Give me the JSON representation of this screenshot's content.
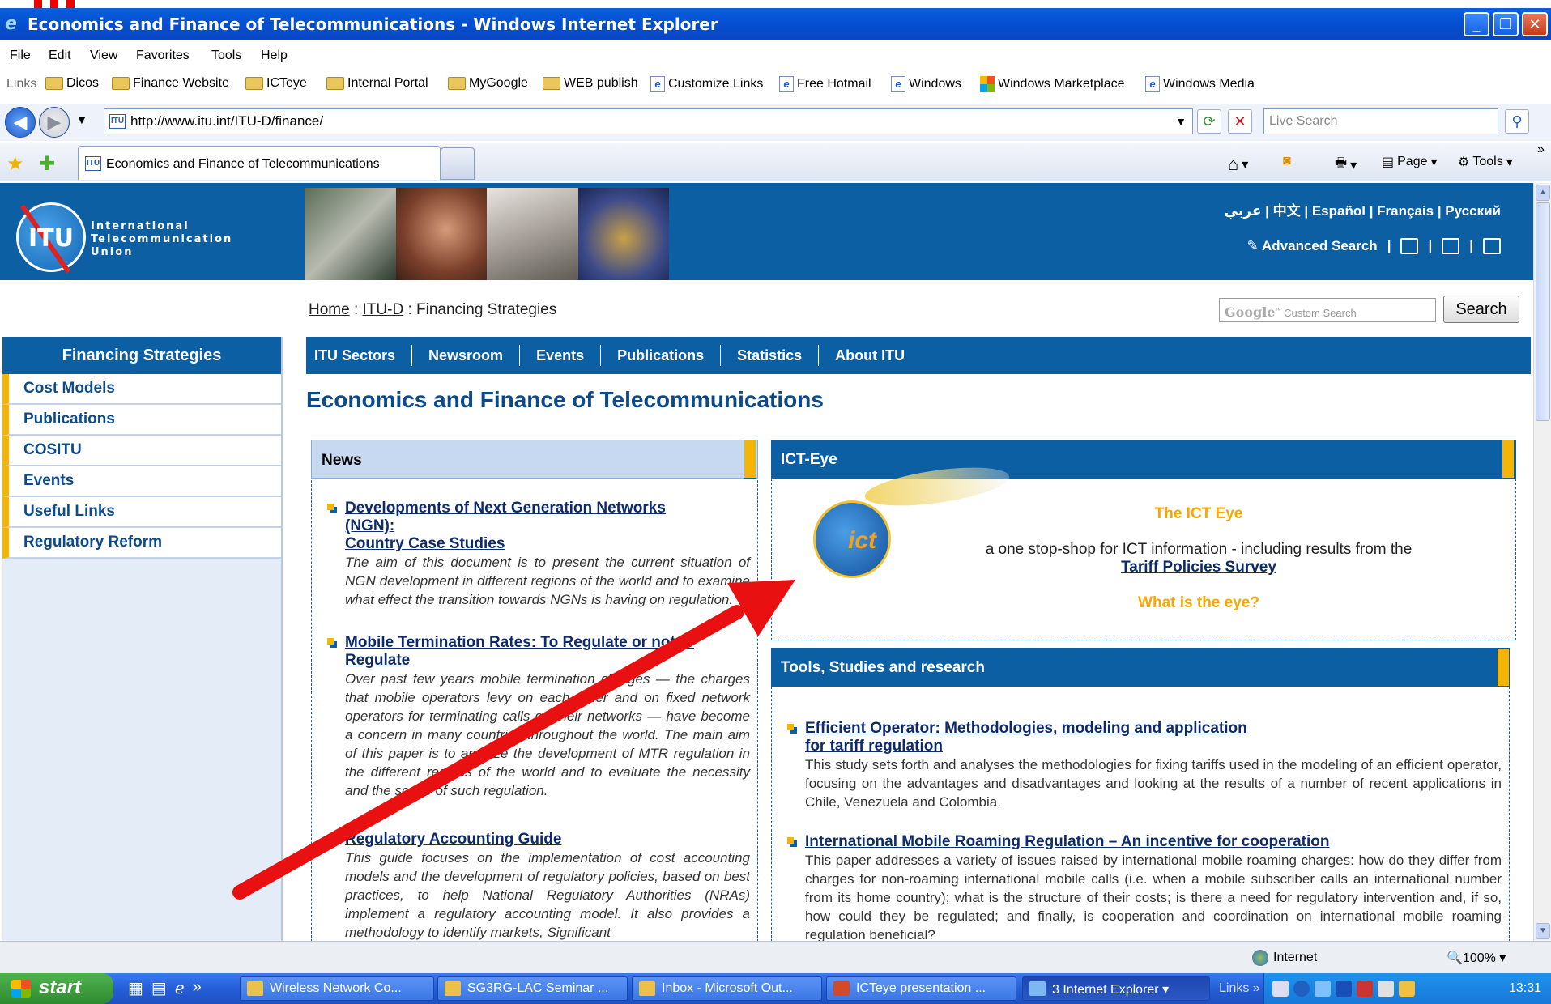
{
  "window": {
    "title": "Economics and Finance of Telecommunications - Windows Internet Explorer",
    "buttons": [
      "_",
      "❐",
      "✕"
    ]
  },
  "menu": [
    "File",
    "Edit",
    "View",
    "Favorites",
    "Tools",
    "Help"
  ],
  "links_bar": {
    "label": "Links",
    "items": [
      {
        "label": "Dicos",
        "icon": "folder-icon"
      },
      {
        "label": "Finance Website",
        "icon": "folder-icon"
      },
      {
        "label": "ICTeye",
        "icon": "folder-icon"
      },
      {
        "label": "Internal Portal",
        "icon": "folder-icon"
      },
      {
        "label": "MyGoogle",
        "icon": "folder-icon"
      },
      {
        "label": "WEB publish",
        "icon": "folder-icon"
      },
      {
        "label": "Customize Links",
        "icon": "ie-page-icon"
      },
      {
        "label": "Free Hotmail",
        "icon": "ie-page-icon"
      },
      {
        "label": "Windows",
        "icon": "ie-page-icon"
      },
      {
        "label": "Windows Marketplace",
        "icon": "windows-icon"
      },
      {
        "label": "Windows Media",
        "icon": "ie-page-icon"
      }
    ]
  },
  "address": {
    "url": "http://www.itu.int/ITU-D/finance/",
    "search_placeholder": "Live Search"
  },
  "tab": {
    "title": "Economics and Finance of Telecommunications"
  },
  "command_bar": {
    "page": "Page",
    "tools": "Tools"
  },
  "itu": {
    "org_name": [
      "International",
      "Telecommunication",
      "Union"
    ],
    "logo_text": "ITU",
    "languages": "عربي | 中文 | Español | Français | Русский",
    "advanced_search": "Advanced Search"
  },
  "breadcrumb": {
    "home": "Home",
    "sep1": " : ",
    "itud": "ITU-D",
    "sep2": " : ",
    "current": "Financing Strategies"
  },
  "google_search": {
    "brand": "Google",
    "placeholder": "Custom Search",
    "button": "Search"
  },
  "left_nav": {
    "title": "Financing Strategies",
    "items": [
      "Cost Models",
      "Publications",
      "COSITU",
      "Events",
      "Useful Links",
      "Regulatory Reform"
    ]
  },
  "top_nav": [
    "ITU Sectors",
    "Newsroom",
    "Events",
    "Publications",
    "Statistics",
    "About ITU"
  ],
  "page_title": "Economics and Finance of Telecommunications",
  "news": {
    "heading": "News",
    "items": [
      {
        "title_lines": [
          "Developments of Next Generation Networks",
          "(NGN):",
          "Country Case Studies"
        ],
        "text": "The aim of this document is to present the current situation of NGN development in different regions of the world and to examine what effect the transition towards NGNs is having on regulation."
      },
      {
        "title_lines": [
          "Mobile Termination Rates:  To Regulate or not to",
          "Regulate"
        ],
        "text": "Over past few years mobile termination charges — the charges that mobile operators levy on each other and on fixed network operators for terminating calls on their networks — have become a concern in many countries throughout the world. The main aim of this paper is to analyze the development of MTR regulation in the different regions of the world and to evaluate the necessity and the scope of such regulation."
      },
      {
        "title_lines": [
          "Regulatory Accounting Guide"
        ],
        "text": "This guide focuses on the implementation of cost accounting models and the development of regulatory policies, based on best practices, to help National Regulatory Authorities (NRAs) implement a regulatory accounting model. It also provides a methodology to identify markets, Significant"
      }
    ]
  },
  "ict_eye": {
    "heading": "ICT-Eye",
    "logo_text": "ict",
    "title": "The ICT Eye",
    "description": "a one stop-shop for ICT information - including results from the",
    "link": "Tariff Policies Survey",
    "what": "What is the eye?"
  },
  "tools": {
    "heading": "Tools, Studies and research",
    "items": [
      {
        "title_lines": [
          "Efficient Operator:  Methodologies, modeling and application",
          "for tariff regulation"
        ],
        "text": "This study sets forth and analyses the methodologies for fixing tariffs used in the modeling of an efficient operator, focusing on the advantages and disadvantages and looking at the results of a number of recent applications in Chile, Venezuela and Colombia."
      },
      {
        "title_lines": [
          "International Mobile Roaming Regulation – An incentive for cooperation"
        ],
        "text": "This paper addresses a variety of issues raised by international mobile roaming charges: how do they differ from charges for non-roaming international mobile calls (i.e. when a mobile subscriber calls an international number from its home country); what is the structure of their costs; is there a need for regulatory intervention and, if so, how could they be regulated; and finally, is cooperation and coordination on international mobile roaming regulation beneficial?"
      }
    ]
  },
  "status_bar": {
    "zone": "Internet",
    "zoom": "100%"
  },
  "taskbar": {
    "start": "start",
    "tasks": [
      "Wireless Network Co...",
      "SG3RG-LAC Seminar ...",
      "Inbox - Microsoft Out...",
      "ICTeye presentation ...",
      "3 Internet Explorer"
    ],
    "links": "Links",
    "clock": "13:31"
  },
  "colors": {
    "itu_blue": "#0d5fa4",
    "accent_yellow": "#f4b400",
    "annotation_arrow": "#e81010"
  }
}
